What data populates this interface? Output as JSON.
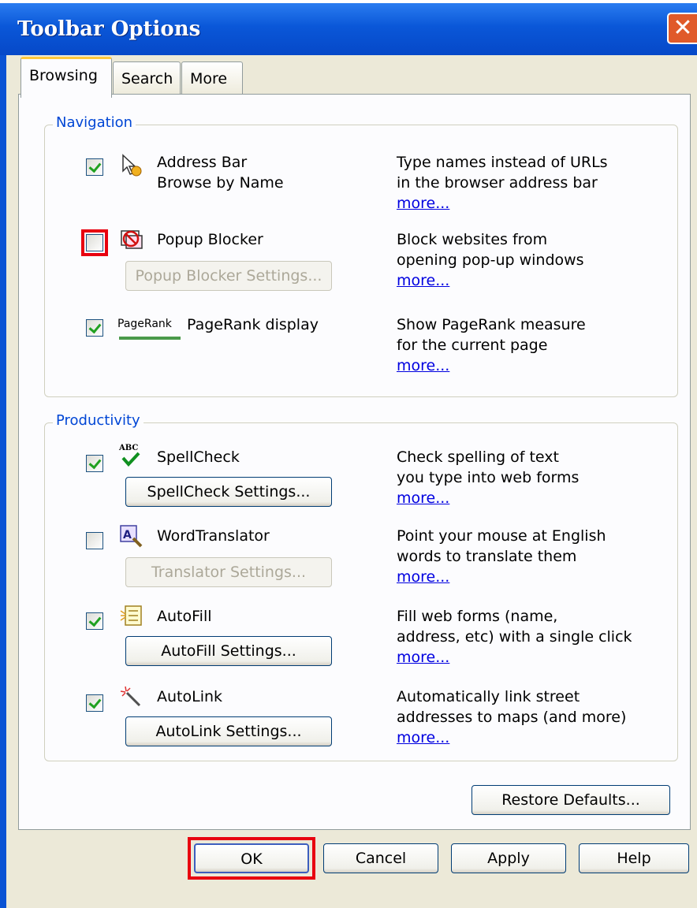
{
  "window": {
    "title": "Toolbar Options",
    "close_glyph": "✕"
  },
  "tabs": [
    {
      "label": "Browsing",
      "active": true
    },
    {
      "label": "Search",
      "active": false
    },
    {
      "label": "More",
      "active": false
    }
  ],
  "navigation": {
    "legend": "Navigation",
    "features": [
      {
        "label_line1": "Address Bar",
        "label_line2": "Browse by Name",
        "checked": true,
        "icon": "cursor-icon",
        "desc_line1": "Type names instead of URLs",
        "desc_line2": "in the browser address bar",
        "more": "more..."
      },
      {
        "label_line1": "Popup Blocker",
        "checked": false,
        "icon": "popup-blocker-icon",
        "button": "Popup Blocker Settings...",
        "button_enabled": false,
        "desc_line1": "Block websites from",
        "desc_line2": "opening pop-up windows",
        "more": "more..."
      },
      {
        "label_line1": "PageRank display",
        "checked": true,
        "icon_text": "PageRank",
        "desc_line1": "Show PageRank measure",
        "desc_line2": "for the current page",
        "more": "more..."
      }
    ]
  },
  "productivity": {
    "legend": "Productivity",
    "features": [
      {
        "label_line1": "SpellCheck",
        "checked": true,
        "icon": "spellcheck-icon",
        "icon_text": "ABC",
        "button": "SpellCheck Settings...",
        "button_enabled": true,
        "desc_line1": "Check spelling of text",
        "desc_line2": "you type into web forms",
        "more": "more..."
      },
      {
        "label_line1": "WordTranslator",
        "checked": false,
        "icon": "translator-icon",
        "button": "Translator Settings...",
        "button_enabled": false,
        "desc_line1": "Point your mouse at English",
        "desc_line2": "words to translate them",
        "more": "more..."
      },
      {
        "label_line1": "AutoFill",
        "checked": true,
        "icon": "autofill-icon",
        "button": "AutoFill Settings...",
        "button_enabled": true,
        "desc_line1": "Fill web forms (name,",
        "desc_line2": "address, etc) with a single click",
        "more": "more..."
      },
      {
        "label_line1": "AutoLink",
        "checked": true,
        "icon": "autolink-icon",
        "button": "AutoLink Settings...",
        "button_enabled": true,
        "desc_line1": "Automatically link street",
        "desc_line2": "addresses to maps (and more)",
        "more": "more..."
      }
    ]
  },
  "buttons": {
    "restore": "Restore Defaults...",
    "ok": "OK",
    "cancel": "Cancel",
    "apply": "Apply",
    "help": "Help"
  },
  "colors": {
    "highlight": "#e8000f",
    "titlebar": "#0a57d8",
    "link": "#0000e0",
    "legend": "#0046d5"
  }
}
